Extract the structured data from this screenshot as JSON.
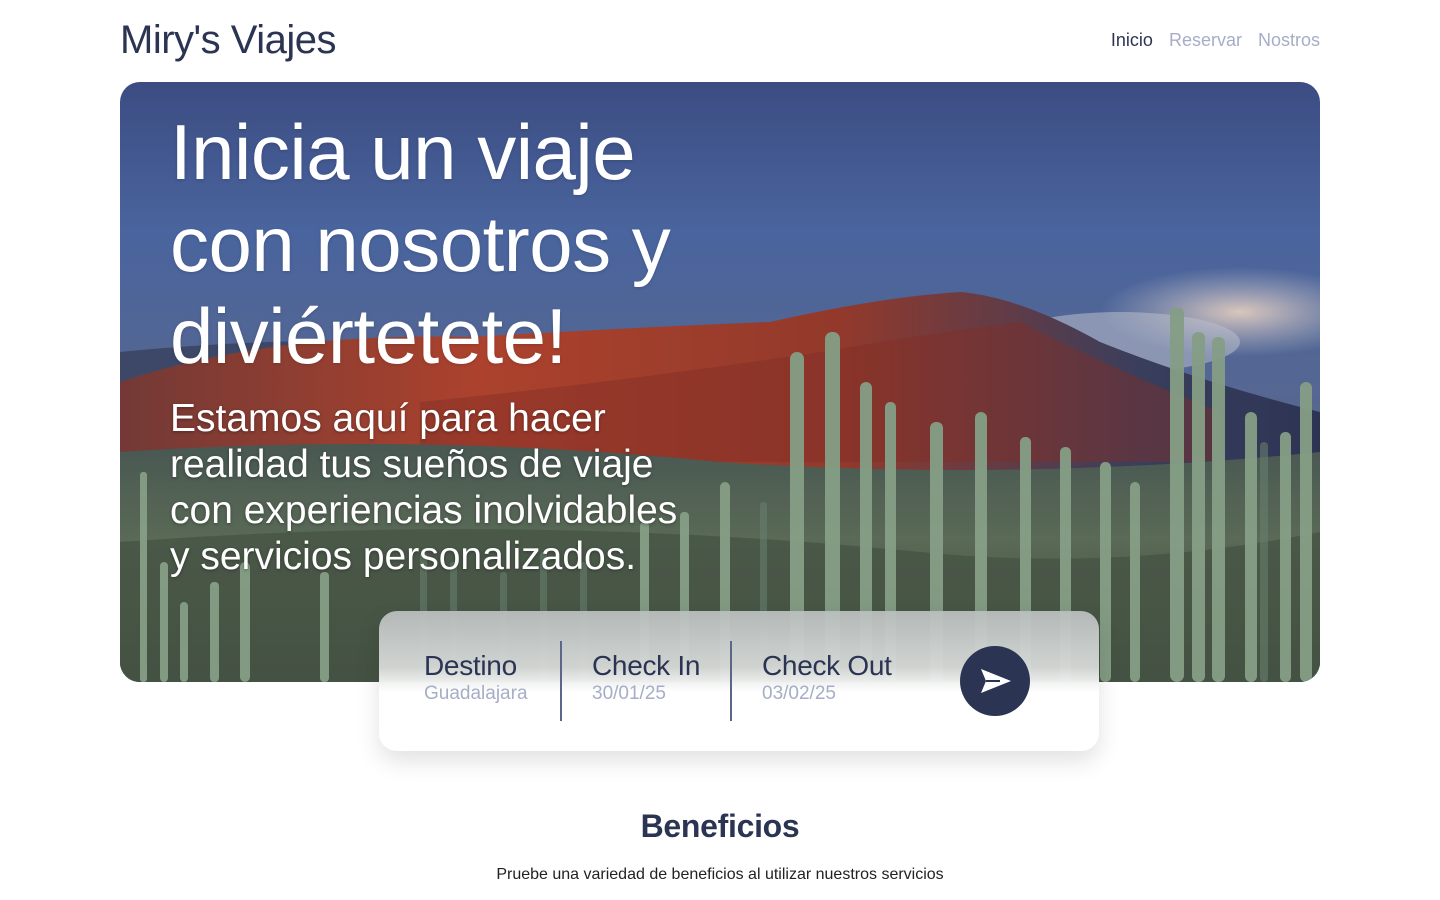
{
  "header": {
    "logo": "Miry's Viajes",
    "nav": [
      {
        "label": "Inicio",
        "active": true
      },
      {
        "label": "Reservar",
        "active": false
      },
      {
        "label": "Nostros",
        "active": false
      }
    ]
  },
  "hero": {
    "title_lines": [
      "Inicia un viaje",
      "con nosotros y",
      "diviértetete!"
    ],
    "subtitle_lines": [
      "Estamos aquí para hacer",
      "realidad tus sueños de viaje",
      "con experiencias inolvidables",
      "y servicios personalizados."
    ],
    "image": "desert-cactus-mountain-landscape"
  },
  "booking": {
    "destino": {
      "label": "Destino",
      "value": "Guadalajara"
    },
    "check_in": {
      "label": "Check In",
      "value": "30/01/25"
    },
    "check_out": {
      "label": "Check Out",
      "value": "03/02/25"
    },
    "submit_icon": "send-icon"
  },
  "benefits": {
    "title": "Beneficios",
    "subtitle": "Pruebe una variedad de beneficios al utilizar nuestros servicios"
  },
  "colors": {
    "primary": "#2b3453",
    "muted": "#a5aec6",
    "white": "#ffffff"
  }
}
